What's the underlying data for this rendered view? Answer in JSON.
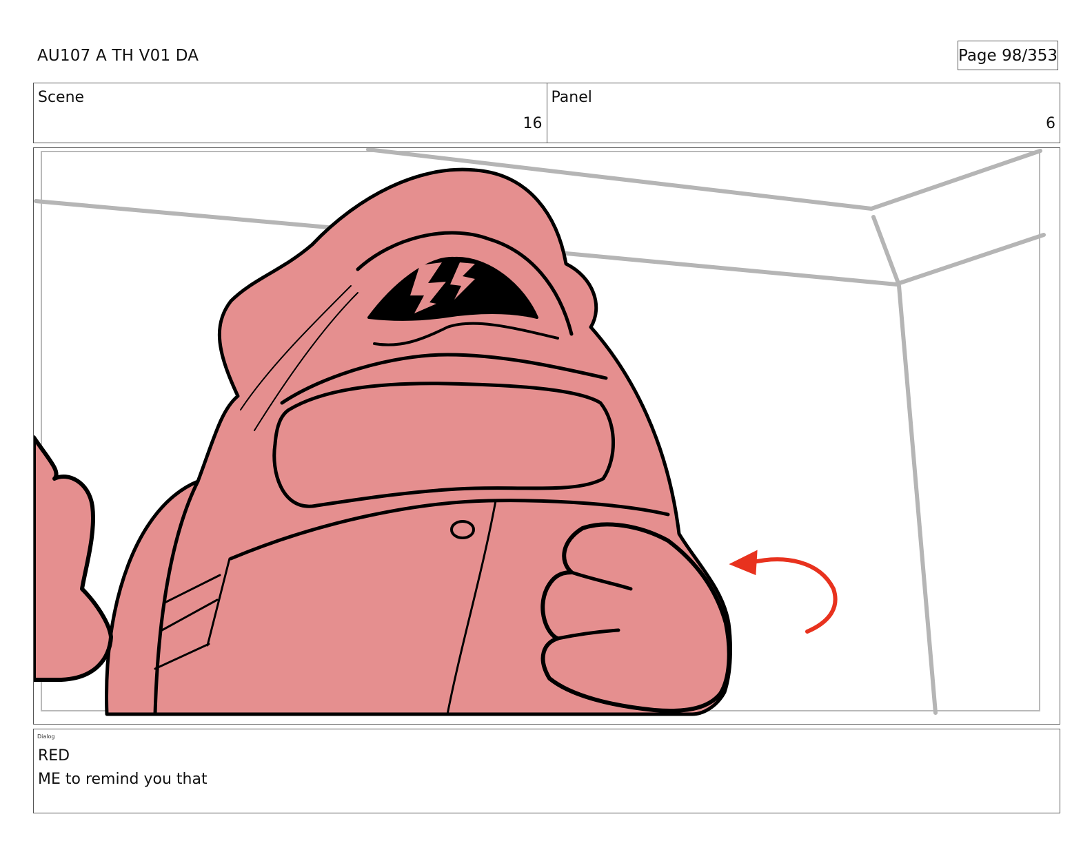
{
  "header": {
    "doc_title": "AU107 A TH V01 DA",
    "page_label": "Page",
    "page_number": "98/353"
  },
  "info": {
    "scene_label": "Scene",
    "scene_value": "16",
    "panel_label": "Panel",
    "panel_value": "6"
  },
  "dialog": {
    "label": "Dialog",
    "speaker": "RED",
    "line": "ME to remind you that"
  },
  "artwork": {
    "character_fill": "#e58f8f",
    "outline": "#000000",
    "room_lines": "#b5b5b5",
    "arrow_color": "#e8321e"
  }
}
